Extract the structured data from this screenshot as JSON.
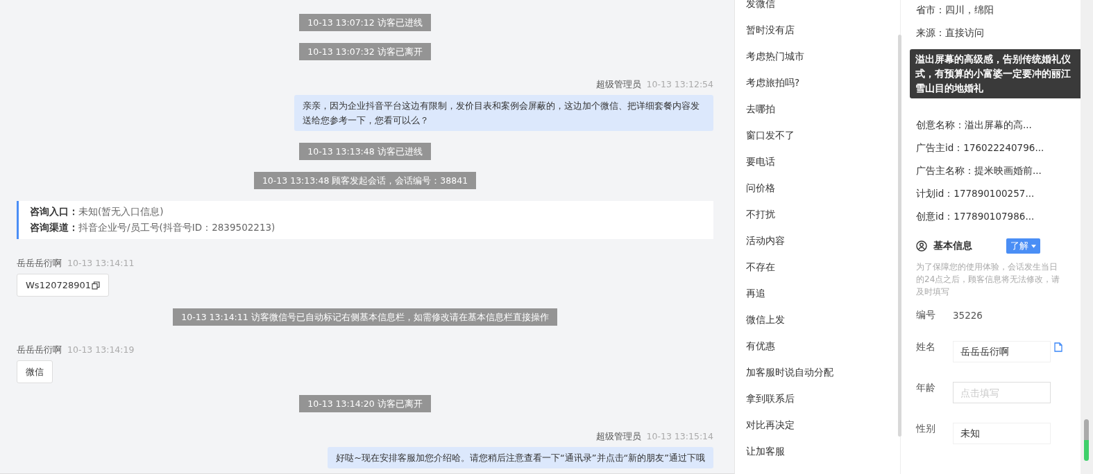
{
  "chat": {
    "messages": [
      {
        "kind": "system",
        "text": "10-13 13:07:12 访客已进线"
      },
      {
        "kind": "system",
        "text": "10-13 13:07:32 访客已离开"
      },
      {
        "kind": "agent",
        "sender": "超级管理员",
        "time": "10-13 13:12:54",
        "text": "亲亲，因为企业抖音平台这边有限制，发价目表和案例会屏蔽的，这边加个微信、把详细套餐内容发送给您参考一下，您看可以么？"
      },
      {
        "kind": "system",
        "text": "10-13 13:13:48 访客已进线"
      },
      {
        "kind": "system",
        "text": "10-13 13:13:48 顾客发起会话，会话编号：38841"
      },
      {
        "kind": "info",
        "rows": [
          {
            "label": "咨询入口：",
            "value": "未知(暂无入口信息)"
          },
          {
            "label": "咨询渠道：",
            "value": "抖音企业号/员工号(抖音号ID：2839502213)"
          }
        ]
      },
      {
        "kind": "visitor",
        "sender": "岳岳岳衍啊",
        "time": "10-13 13:14:11",
        "text": "Ws120728901",
        "copyable": true
      },
      {
        "kind": "system",
        "text": "10-13 13:14:11 访客微信号已自动标记右侧基本信息栏，如需修改请在基本信息栏直接操作"
      },
      {
        "kind": "visitor",
        "sender": "岳岳岳衍啊",
        "time": "10-13 13:14:19",
        "text": "微信",
        "copyable": false
      },
      {
        "kind": "system",
        "text": "10-13 13:14:20 访客已离开"
      },
      {
        "kind": "agent",
        "sender": "超级管理员",
        "time": "10-13 13:15:14",
        "text": "好哒~现在安排客服加您介绍哈。请您稍后注意查看一下“通讯录”并点击“新的朋友”通过下哦"
      }
    ]
  },
  "quick_replies": [
    "发微信",
    "暂时没有店",
    "考虑热门城市",
    "考虑旅拍吗?",
    "去哪拍",
    "窗口发不了",
    "要电话",
    "问价格",
    "不打扰",
    "活动内容",
    "不存在",
    "再追",
    "微信上发",
    "有优惠",
    "加客服时说自动分配",
    "拿到联系后",
    "对比再决定",
    "让加客服"
  ],
  "visitor_details": {
    "rows": [
      "省市：四川，绵阳",
      "来源：直接访问"
    ],
    "tooltip": "溢出屏幕的高级感，告别传统婚礼仪式，有预算的小富婆一定要冲的丽江雪山目的地婚礼",
    "rows_below_tooltip": [
      "创意名称：溢出屏幕的高...",
      "广告主id：176022240796...",
      "广告主名称：提米映画婚前...",
      "计划id：177890100257...",
      "创意id：177890107986..."
    ]
  },
  "basic_info": {
    "title": "基本信息",
    "button": "了解",
    "note": "为了保障您的使用体验，会话发生当日的24点之后，顾客信息将无法修改，请及时填写",
    "fields": [
      {
        "kind": "static",
        "label": "编号",
        "value": "35226"
      },
      {
        "kind": "input",
        "label": "姓名",
        "value": "岳岳岳衍啊",
        "copy": true
      },
      {
        "kind": "input",
        "label": "年龄",
        "placeholder": "点击填写"
      },
      {
        "kind": "input",
        "label": "性别",
        "value": "未知"
      }
    ]
  }
}
